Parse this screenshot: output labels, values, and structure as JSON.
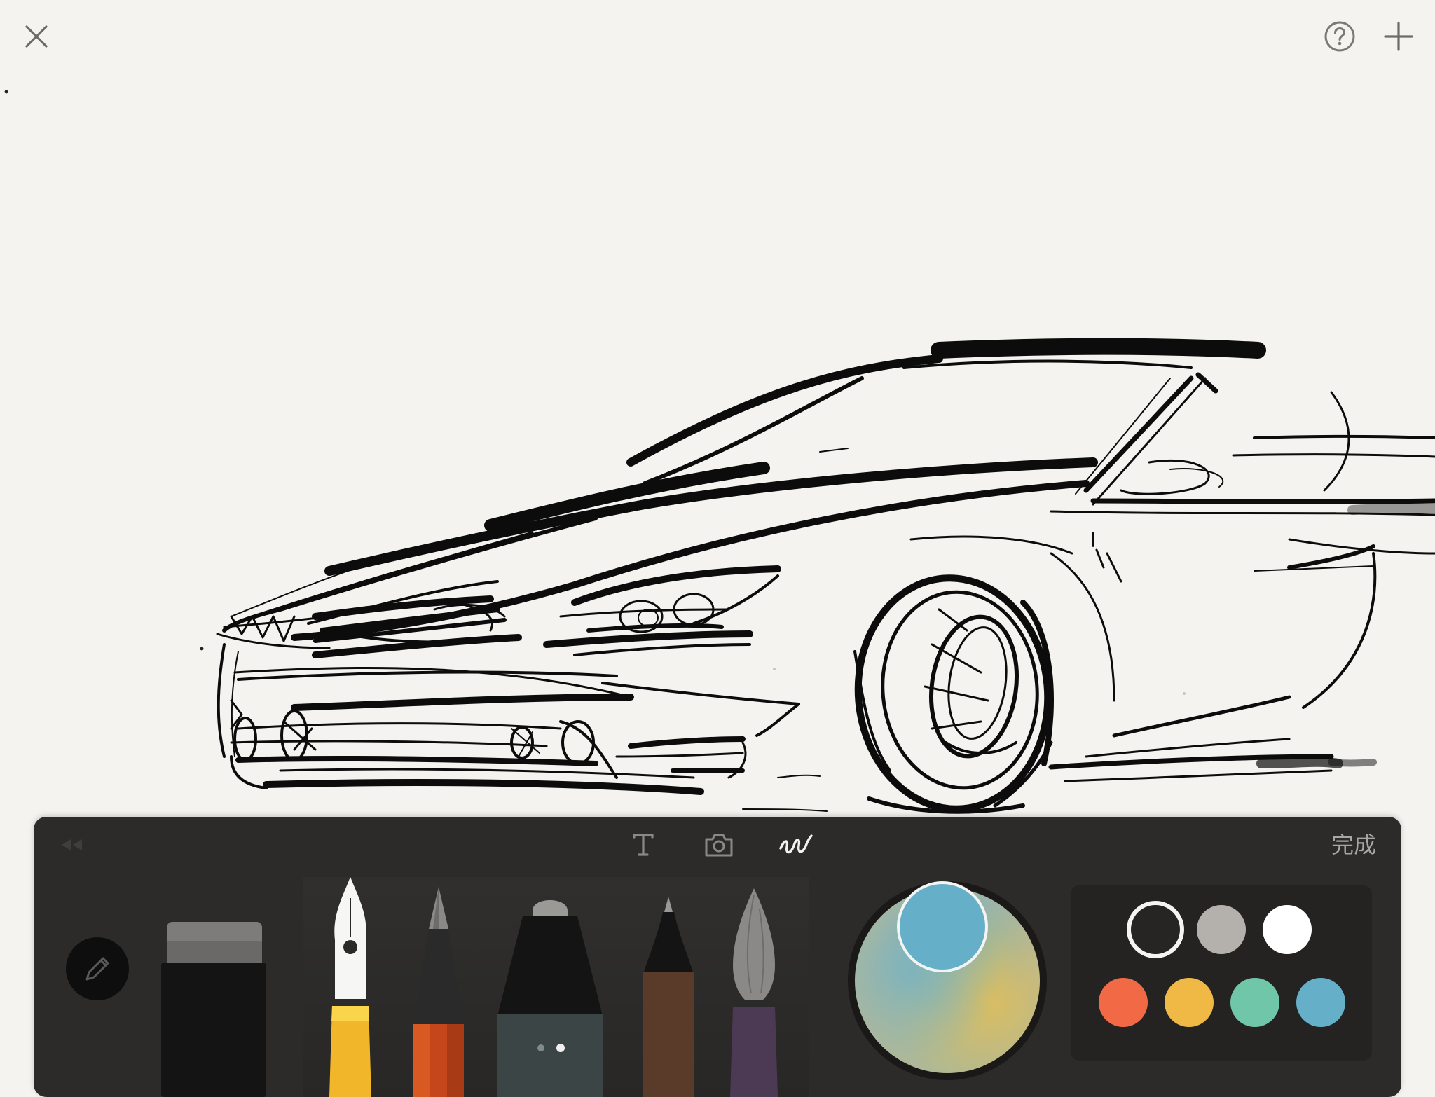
{
  "top_bar": {
    "close_icon": "close-icon",
    "help_icon": "help-icon",
    "add_icon": "plus-icon"
  },
  "toolbar": {
    "rewind_icon": "rewind-icon",
    "tabs": [
      {
        "icon": "text-icon",
        "active": false
      },
      {
        "icon": "camera-icon",
        "active": false
      },
      {
        "icon": "draw-icon",
        "active": true
      }
    ],
    "done_label": "完成",
    "mode_icon": "pencil-icon",
    "tools": [
      "eraser",
      "fountain-pen",
      "pencil",
      "marker",
      "fineliner",
      "watercolor-brush"
    ],
    "marker_page_dots": 2,
    "current_color": "#65b0c8",
    "palette": {
      "selected": "#262523",
      "colors": [
        "#262523",
        "#b4b0ab",
        "#ffffff",
        "#f26a45",
        "#f0b945",
        "#6fc6a9",
        "#65b0c8"
      ]
    }
  }
}
